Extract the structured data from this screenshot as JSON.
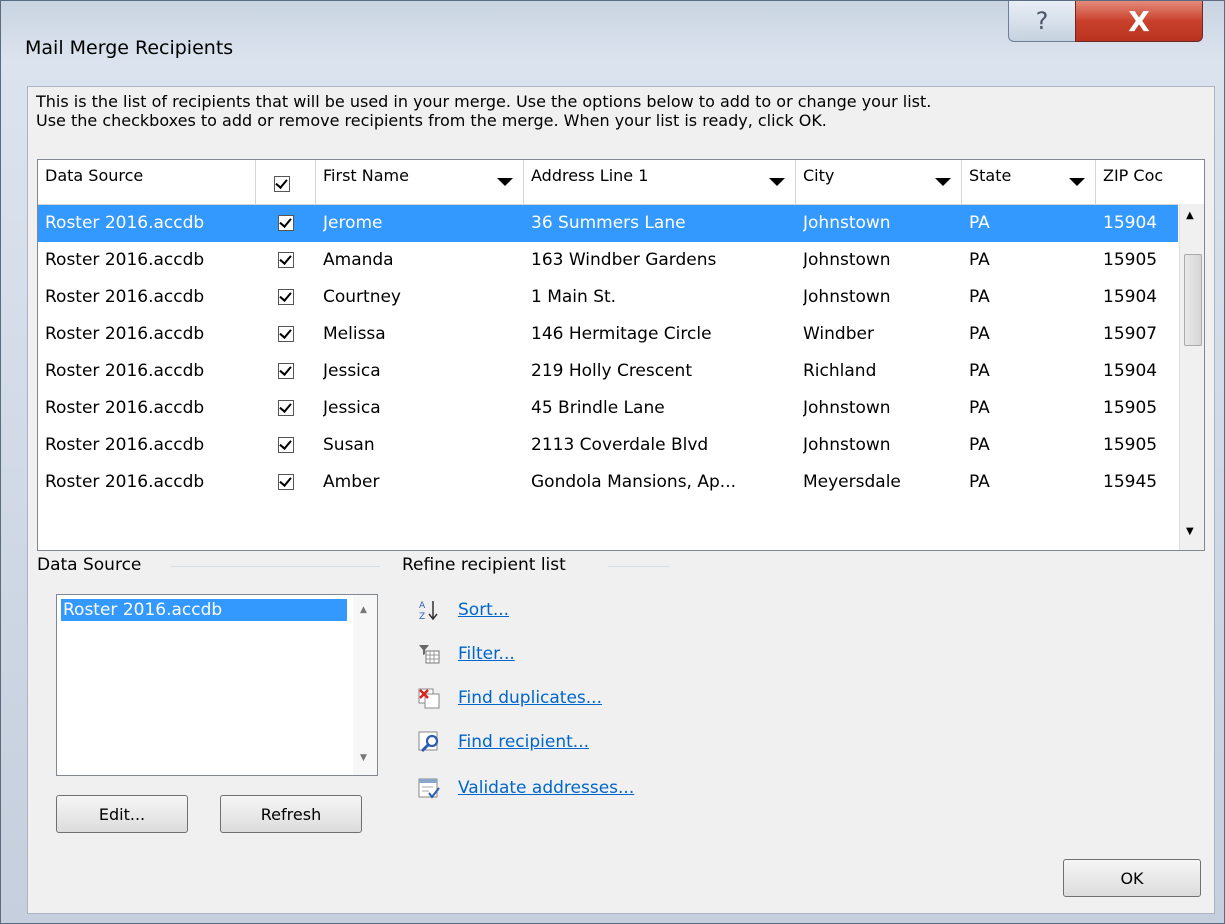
{
  "window": {
    "title": "Mail Merge Recipients",
    "help_label": "?",
    "close_label": "X"
  },
  "description": {
    "line1": "This is the list of recipients that will be used in your merge.  Use the options below to add to or change your list.",
    "line2": "Use the checkboxes to add or remove recipients from the merge.  When your list is ready, click OK."
  },
  "grid": {
    "columns": [
      "Data Source",
      "",
      "First Name",
      "Address Line 1",
      "City",
      "State",
      "ZIP Coc"
    ],
    "rows": [
      {
        "source": "Roster 2016.accdb",
        "checked": true,
        "first": "Jerome",
        "address": "36 Summers Lane",
        "city": "Johnstown",
        "state": "PA",
        "zip": "15904",
        "selected": true
      },
      {
        "source": "Roster 2016.accdb",
        "checked": true,
        "first": "Amanda",
        "address": "163 Windber Gardens",
        "city": "Johnstown",
        "state": "PA",
        "zip": "15905"
      },
      {
        "source": "Roster 2016.accdb",
        "checked": true,
        "first": "Courtney",
        "address": "1 Main St.",
        "city": "Johnstown",
        "state": "PA",
        "zip": "15904"
      },
      {
        "source": "Roster 2016.accdb",
        "checked": true,
        "first": "Melissa",
        "address": "146 Hermitage Circle",
        "city": "Windber",
        "state": "PA",
        "zip": "15907"
      },
      {
        "source": "Roster 2016.accdb",
        "checked": true,
        "first": "Jessica",
        "address": "219 Holly Crescent",
        "city": "Richland",
        "state": "PA",
        "zip": "15904"
      },
      {
        "source": "Roster 2016.accdb",
        "checked": true,
        "first": "Jessica",
        "address": "45 Brindle Lane",
        "city": "Johnstown",
        "state": "PA",
        "zip": "15905"
      },
      {
        "source": "Roster 2016.accdb",
        "checked": true,
        "first": "Susan",
        "address": "2113 Coverdale Blvd",
        "city": "Johnstown",
        "state": "PA",
        "zip": "15905"
      },
      {
        "source": "Roster 2016.accdb",
        "checked": true,
        "first": "Amber",
        "address": "Gondola Mansions, Ap...",
        "city": "Meyersdale",
        "state": "PA",
        "zip": "15945"
      }
    ]
  },
  "data_source": {
    "heading": "Data Source",
    "items": [
      "Roster 2016.accdb"
    ],
    "edit_label": "Edit...",
    "refresh_label": "Refresh"
  },
  "refine": {
    "heading": "Refine recipient list",
    "links": [
      {
        "label": "Sort...",
        "icon": "sort-az-icon"
      },
      {
        "label": "Filter...",
        "icon": "filter-icon"
      },
      {
        "label": "Find duplicates...",
        "icon": "find-duplicates-icon"
      },
      {
        "label": "Find recipient...",
        "icon": "find-recipient-icon"
      },
      {
        "label": "Validate addresses...",
        "icon": "validate-addresses-icon"
      }
    ]
  },
  "ok_label": "OK",
  "colors": {
    "selection": "#3399ff",
    "link": "#0066cc",
    "close": "#c9412c"
  }
}
